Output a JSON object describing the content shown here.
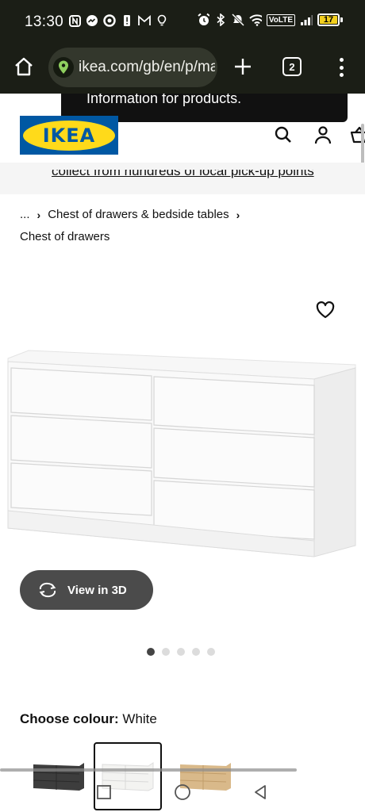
{
  "status_bar": {
    "time": "13:30",
    "network": "VoLTE",
    "battery": "17"
  },
  "browser": {
    "url": "ikea.com/gb/en/p/ma",
    "tab_count": "2"
  },
  "site": {
    "logo_text": "IKEA",
    "toast_text": "Information for products.",
    "banner_text": "collect from hundreds of local pick-up points",
    "brand_colors": {
      "blue": "#0058a3",
      "yellow": "#ffda1a"
    }
  },
  "breadcrumb": {
    "ellipsis": "...",
    "separator": "›",
    "parent": "Chest of drawers & bedside tables"
  },
  "category_label": "Chest of drawers",
  "product": {
    "view_3d_label": "View in 3D",
    "image_index": 1,
    "image_count": 5
  },
  "colour": {
    "label": "Choose colour:",
    "value": "White",
    "swatches": [
      {
        "name": "black-brown",
        "color": "#3d3d3d",
        "selected": false
      },
      {
        "name": "white",
        "color": "#f3f3f1",
        "selected": true
      },
      {
        "name": "oak",
        "color": "#d9b98a",
        "selected": false
      }
    ]
  }
}
